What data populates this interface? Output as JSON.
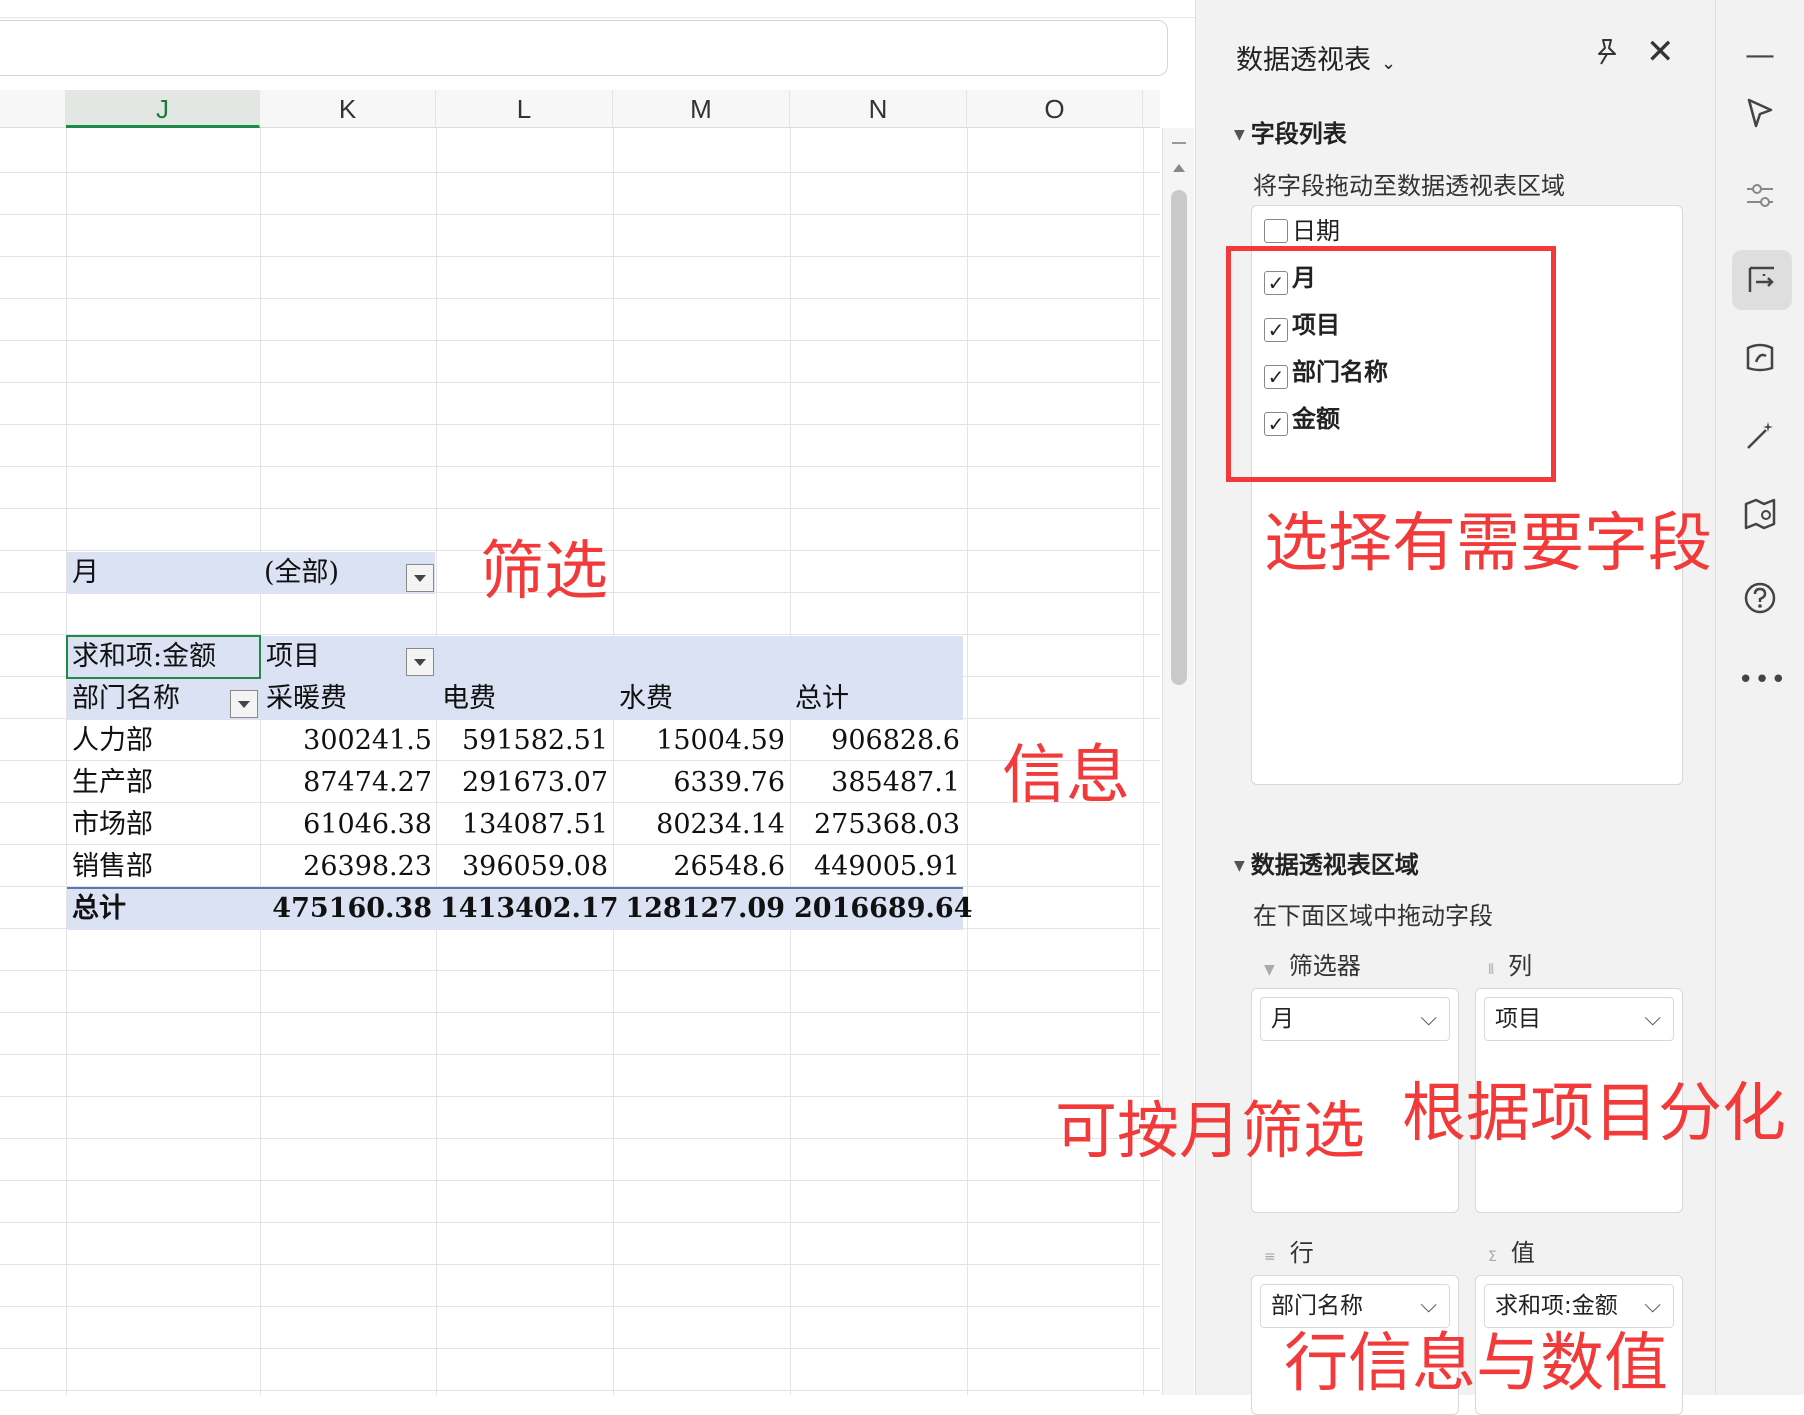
{
  "spreadsheet": {
    "columns": [
      "J",
      "K",
      "L",
      "M",
      "N",
      "O"
    ],
    "active_column": "J"
  },
  "pivot": {
    "filter_label": "月",
    "filter_value": "(全部)",
    "value_header": "求和项:金额",
    "column_field": "项目",
    "row_field": "部门名称",
    "column_items": [
      "采暖费",
      "电费",
      "水费",
      "总计"
    ],
    "rows": [
      {
        "name": "人力部",
        "values": [
          "300241.5",
          "591582.51",
          "15004.59",
          "906828.6"
        ]
      },
      {
        "name": "生产部",
        "values": [
          "87474.27",
          "291673.07",
          "6339.76",
          "385487.1"
        ]
      },
      {
        "name": "市场部",
        "values": [
          "61046.38",
          "134087.51",
          "80234.14",
          "275368.03"
        ]
      },
      {
        "name": "销售部",
        "values": [
          "26398.23",
          "396059.08",
          "26548.6",
          "449005.91"
        ]
      }
    ],
    "total": {
      "name": "总计",
      "values": [
        "475160.38",
        "1413402.17",
        "128127.09",
        "2016689.64"
      ]
    }
  },
  "pane": {
    "title": "数据透视表",
    "field_section": "字段列表",
    "field_hint": "将字段拖动至数据透视表区域",
    "fields": [
      {
        "label": "日期",
        "checked": false
      },
      {
        "label": "月",
        "checked": true
      },
      {
        "label": "项目",
        "checked": true
      },
      {
        "label": "部门名称",
        "checked": true
      },
      {
        "label": "金额",
        "checked": true
      }
    ],
    "area_section": "数据透视表区域",
    "area_hint": "在下面区域中拖动字段",
    "areas": {
      "filter": {
        "label": "筛选器",
        "item": "月"
      },
      "columns": {
        "label": "列",
        "item": "项目"
      },
      "rows": {
        "label": "行",
        "item": "部门名称"
      },
      "values": {
        "label": "值",
        "item": "求和项:金额"
      }
    }
  },
  "toolbar": {
    "icons": [
      "minimize-icon",
      "pointer-icon",
      "sliders-icon",
      "pivot-icon",
      "style-icon",
      "magic-icon",
      "map-icon",
      "help-icon",
      "more-icon"
    ]
  },
  "annotations": {
    "filter_note": "筛选",
    "info_note": "信息",
    "select_fields_note": "选择有需要字段",
    "month_filter_note": "可按月筛选",
    "project_split_note": "根据项目分化",
    "row_value_note": "行信息与数值"
  },
  "colors": {
    "annotation": "#f23a3a",
    "pivot_band": "#dbe2f3",
    "active_column": "#1f8a45"
  }
}
